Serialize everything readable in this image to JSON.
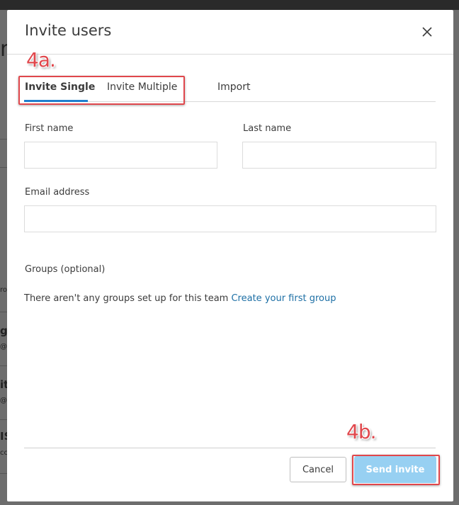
{
  "backdrop": {
    "fragments": [
      "m",
      "ro",
      "g",
      "@",
      "it",
      "@",
      "IS",
      "cc"
    ]
  },
  "modal": {
    "title": "Invite users",
    "tabs": [
      {
        "label": "Invite Single",
        "active": true
      },
      {
        "label": "Invite Multiple",
        "active": false
      },
      {
        "label": "Import",
        "active": false
      }
    ],
    "form": {
      "first_name_label": "First name",
      "first_name_value": "",
      "last_name_label": "Last name",
      "last_name_value": "",
      "email_label": "Email address",
      "email_value": ""
    },
    "groups": {
      "label": "Groups (optional)",
      "empty_text": "There aren't any groups set up for this team",
      "create_link": "Create your first group"
    },
    "footer": {
      "cancel_label": "Cancel",
      "send_label": "Send invite"
    }
  },
  "annotations": {
    "tabs_label": "4a.",
    "send_label": "4b."
  },
  "colors": {
    "accent": "#1f7fcf",
    "link": "#1d6fa5",
    "send_button": "#97d0f2",
    "annotation": "#e0474c"
  },
  "icons": {
    "close": "close-icon"
  }
}
